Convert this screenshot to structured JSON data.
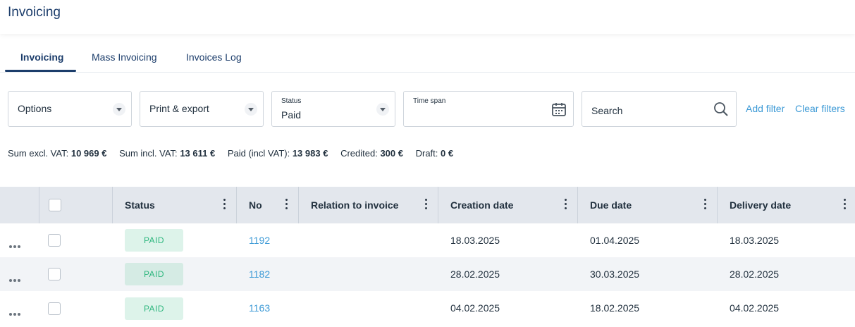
{
  "header": {
    "title": "Invoicing"
  },
  "tabs": [
    {
      "label": "Invoicing"
    },
    {
      "label": "Mass Invoicing"
    },
    {
      "label": "Invoices Log"
    }
  ],
  "filters": {
    "options": "Options",
    "print_export": "Print & export",
    "status_label": "Status",
    "status_value": "Paid",
    "timespan_label": "Time span",
    "search_placeholder": "Search",
    "add_filter": "Add filter",
    "clear_filters": "Clear filters"
  },
  "sums": {
    "excl_label": "Sum excl. VAT:",
    "excl_value": "10 969 €",
    "incl_label": "Sum incl. VAT:",
    "incl_value": "13 611 €",
    "paid_label": "Paid (incl VAT):",
    "paid_value": "13 983 €",
    "credited_label": "Credited:",
    "credited_value": "300 €",
    "draft_label": "Draft:",
    "draft_value": "0 €"
  },
  "table": {
    "columns": [
      "Status",
      "No",
      "Relation to invoice",
      "Creation date",
      "Due date",
      "Delivery date"
    ],
    "rows": [
      {
        "status": "PAID",
        "no": "1192",
        "relation": "",
        "created": "18.03.2025",
        "due": "01.04.2025",
        "delivery": "18.03.2025"
      },
      {
        "status": "PAID",
        "no": "1182",
        "relation": "",
        "created": "28.02.2025",
        "due": "30.03.2025",
        "delivery": "28.02.2025"
      },
      {
        "status": "PAID",
        "no": "1163",
        "relation": "",
        "created": "04.02.2025",
        "due": "18.02.2025",
        "delivery": "04.02.2025"
      }
    ]
  },
  "colors": {
    "brand": "#1c3d6b",
    "link": "#3d9ad6",
    "paid_badge_text": "#2cb67d",
    "paid_badge_bg": "#ddf3ea"
  }
}
